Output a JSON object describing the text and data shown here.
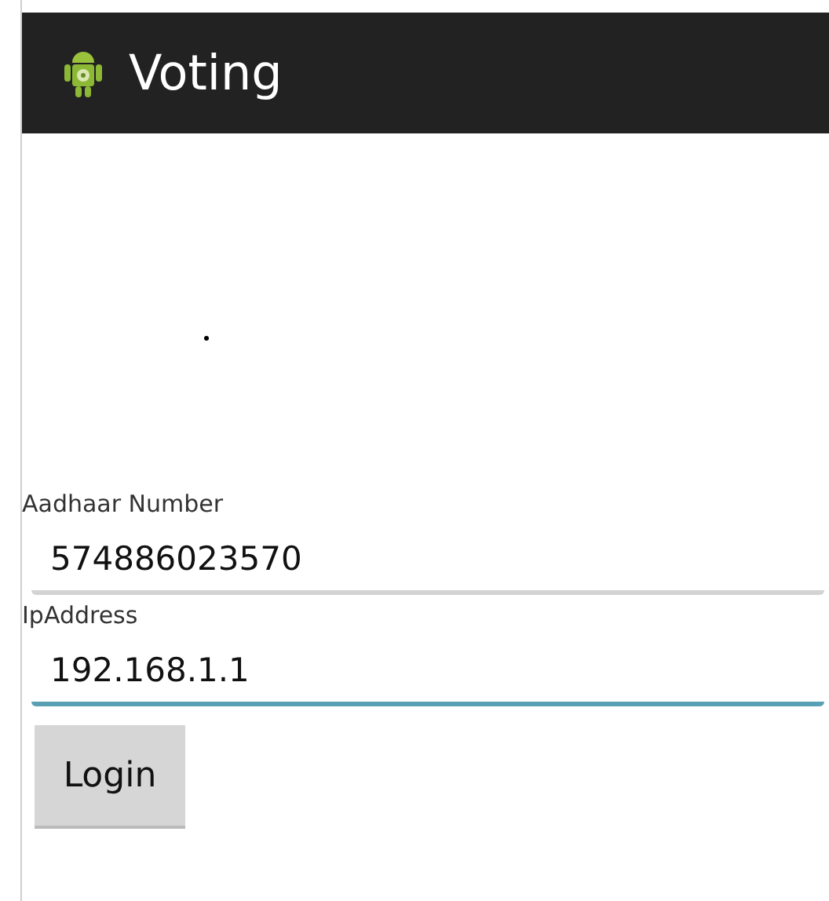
{
  "action_bar": {
    "title": "Voting"
  },
  "fields": [
    {
      "label": "Aadhaar Number",
      "value": "574886023570",
      "focused": false
    },
    {
      "label": "IpAddress",
      "value": "192.168.1.1",
      "focused": true
    }
  ],
  "buttons": [
    {
      "label": "Login"
    }
  ]
}
